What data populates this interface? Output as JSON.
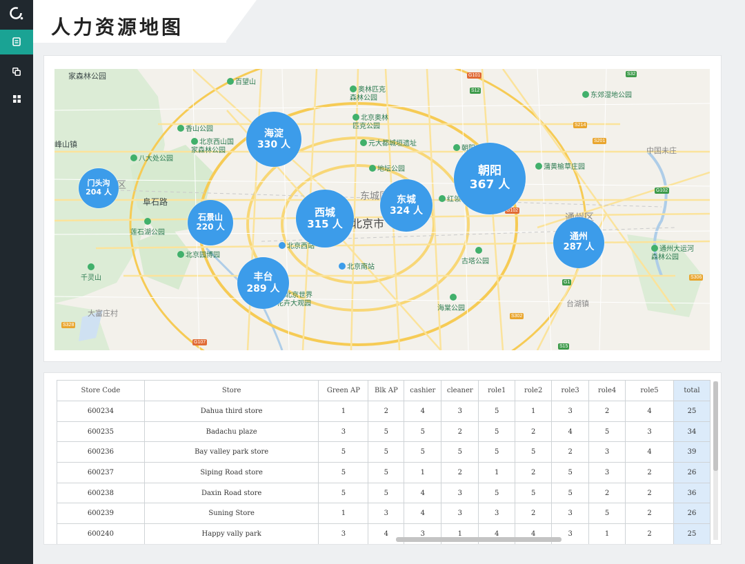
{
  "page": {
    "title": "人力资源地图"
  },
  "sidebar": {
    "logo_icon": "ring-logo-icon",
    "items": [
      {
        "icon": "document-icon",
        "active": true
      },
      {
        "icon": "copy-icon",
        "active": false
      },
      {
        "icon": "grid-icon",
        "active": false
      }
    ]
  },
  "map": {
    "districts": [
      {
        "name": "海淀",
        "count": "330 人"
      },
      {
        "name": "朝阳",
        "count": "367 人"
      },
      {
        "name": "门头沟",
        "count": "204 人"
      },
      {
        "name": "石景山",
        "count": "220 人"
      },
      {
        "name": "西城",
        "count": "315 人"
      },
      {
        "name": "东城",
        "count": "324 人"
      },
      {
        "name": "通州",
        "count": "287 人"
      },
      {
        "name": "丰台",
        "count": "289 人"
      }
    ],
    "labels": {
      "l0": "家森林公园",
      "l1": "峰山镇",
      "l2": "阜石路",
      "l3": "北京市",
      "l4": "东城区",
      "l5": "通州区",
      "l6": "中国未庄",
      "l7": "台湖镇",
      "l8": "大富庄村",
      "l9": "区"
    },
    "pois": {
      "p0": "百望山",
      "p1": "奥林匹克\n森林公园",
      "p2": "东郊湿地公园",
      "p3": "香山公园",
      "p4": "北京西山国\n家森林公园",
      "p5": "北京奥林\n匹克公园",
      "p6": "元大都城垣遗址",
      "p7": "八大处公园",
      "p8": "地坛公园",
      "p9": "朝阳",
      "p10": "蒲黄榆草庄园",
      "p11": "红领",
      "p12": "莲石湖公园",
      "p13": "北京园博园",
      "p14": "北京西站",
      "p15": "北京南站",
      "p16": "古塔公园",
      "p17": "千灵山",
      "p18": "北京世界\n花卉大观园",
      "p19": "海棠公园",
      "p20": "通州大运河\n森林公园"
    },
    "shields": {
      "s0": "G101",
      "s1": "S12",
      "s2": "S32",
      "s3": "S214",
      "s4": "S201",
      "s5": "G102",
      "s6": "G102",
      "s7": "G1",
      "s8": "S302",
      "s9": "S306",
      "s10": "S328",
      "s11": "G107",
      "s12": "S15"
    }
  },
  "table": {
    "headers": [
      "Store Code",
      "Store",
      "Green AP",
      "Blk AP",
      "cashier",
      "cleaner",
      "role1",
      "role2",
      "role3",
      "role4",
      "role5",
      "total"
    ],
    "rows": [
      [
        "600234",
        "Dahua third store",
        "1",
        "2",
        "4",
        "3",
        "5",
        "1",
        "3",
        "2",
        "4",
        "25"
      ],
      [
        "600235",
        "Badachu plaze",
        "3",
        "5",
        "5",
        "2",
        "5",
        "2",
        "4",
        "5",
        "3",
        "34"
      ],
      [
        "600236",
        "Bay valley park store",
        "5",
        "5",
        "5",
        "5",
        "5",
        "5",
        "2",
        "3",
        "4",
        "39"
      ],
      [
        "600237",
        "Siping Road store",
        "5",
        "5",
        "1",
        "2",
        "1",
        "2",
        "5",
        "3",
        "2",
        "26"
      ],
      [
        "600238",
        "Daxin Road store",
        "5",
        "5",
        "4",
        "3",
        "5",
        "5",
        "5",
        "2",
        "2",
        "36"
      ],
      [
        "600239",
        "Suning Store",
        "1",
        "3",
        "4",
        "3",
        "3",
        "2",
        "3",
        "5",
        "2",
        "26"
      ],
      [
        "600240",
        "Happy vally park",
        "3",
        "4",
        "3",
        "1",
        "4",
        "4",
        "3",
        "1",
        "2",
        "25"
      ]
    ]
  }
}
